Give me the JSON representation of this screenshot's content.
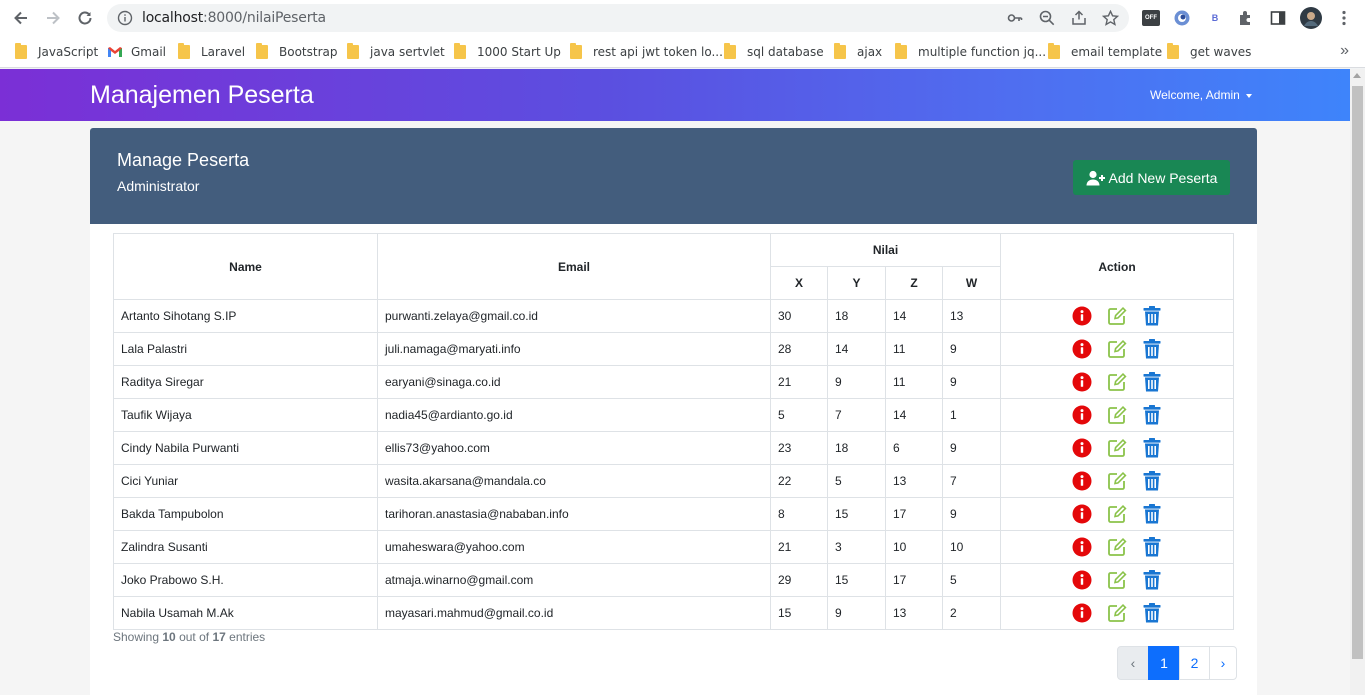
{
  "browser": {
    "url_host": "localhost",
    "url_rest": ":8000/nilaiPeserta",
    "bookmarks": [
      {
        "label": "JavaScript",
        "icon": "folder"
      },
      {
        "label": "Gmail",
        "icon": "gmail"
      },
      {
        "label": "Laravel",
        "icon": "folder"
      },
      {
        "label": "Bootstrap",
        "icon": "folder"
      },
      {
        "label": "java sertvlet",
        "icon": "folder"
      },
      {
        "label": "1000 Start Up",
        "icon": "folder"
      },
      {
        "label": "rest api jwt token lo...",
        "icon": "folder"
      },
      {
        "label": "sql database",
        "icon": "folder"
      },
      {
        "label": "ajax",
        "icon": "folder"
      },
      {
        "label": "multiple function jq...",
        "icon": "folder"
      },
      {
        "label": "email template",
        "icon": "folder"
      },
      {
        "label": "get waves",
        "icon": "folder"
      }
    ],
    "ext_off": "OFF",
    "ext_b": "B"
  },
  "navbar": {
    "brand": "Manajemen Peserta",
    "welcome": "Welcome, Admin"
  },
  "header": {
    "title": "Manage Peserta",
    "subtitle": "Administrator",
    "add_button": "Add New Peserta"
  },
  "table": {
    "headers": {
      "name": "Name",
      "email": "Email",
      "nilai": "Nilai",
      "x": "X",
      "y": "Y",
      "z": "Z",
      "w": "W",
      "action": "Action"
    },
    "rows": [
      {
        "name": "Artanto Sihotang S.IP",
        "email": "purwanti.zelaya@gmail.co.id",
        "x": "30",
        "y": "18",
        "z": "14",
        "w": "13"
      },
      {
        "name": "Lala Palastri",
        "email": "juli.namaga@maryati.info",
        "x": "28",
        "y": "14",
        "z": "11",
        "w": "9"
      },
      {
        "name": "Raditya Siregar",
        "email": "earyani@sinaga.co.id",
        "x": "21",
        "y": "9",
        "z": "11",
        "w": "9"
      },
      {
        "name": "Taufik Wijaya",
        "email": "nadia45@ardianto.go.id",
        "x": "5",
        "y": "7",
        "z": "14",
        "w": "1"
      },
      {
        "name": "Cindy Nabila Purwanti",
        "email": "ellis73@yahoo.com",
        "x": "23",
        "y": "18",
        "z": "6",
        "w": "9"
      },
      {
        "name": "Cici Yuniar",
        "email": "wasita.akarsana@mandala.co",
        "x": "22",
        "y": "5",
        "z": "13",
        "w": "7"
      },
      {
        "name": "Bakda Tampubolon",
        "email": "tarihoran.anastasia@nababan.info",
        "x": "8",
        "y": "15",
        "z": "17",
        "w": "9"
      },
      {
        "name": "Zalindra Susanti",
        "email": "umaheswara@yahoo.com",
        "x": "21",
        "y": "3",
        "z": "10",
        "w": "10"
      },
      {
        "name": "Joko Prabowo S.H.",
        "email": "atmaja.winarno@gmail.com",
        "x": "29",
        "y": "15",
        "z": "17",
        "w": "5"
      },
      {
        "name": "Nabila Usamah M.Ak",
        "email": "mayasari.mahmud@gmail.co.id",
        "x": "15",
        "y": "9",
        "z": "13",
        "w": "2"
      }
    ],
    "action_icons": [
      "info-icon",
      "edit-icon",
      "trash-icon"
    ]
  },
  "footer": {
    "showing_prefix": "Showing",
    "showing_count": "10",
    "showing_mid": "out of",
    "showing_total": "17",
    "showing_suffix": "entries"
  },
  "pagination": {
    "prev": "‹",
    "pages": [
      "1",
      "2"
    ],
    "active": "1",
    "next": "›"
  },
  "colors": {
    "header_bg": "#435d7d",
    "add_button": "#198754",
    "info": "#e4080a",
    "edit": "#8bc34a",
    "delete": "#1976d2",
    "page_active": "#0d6efd"
  }
}
